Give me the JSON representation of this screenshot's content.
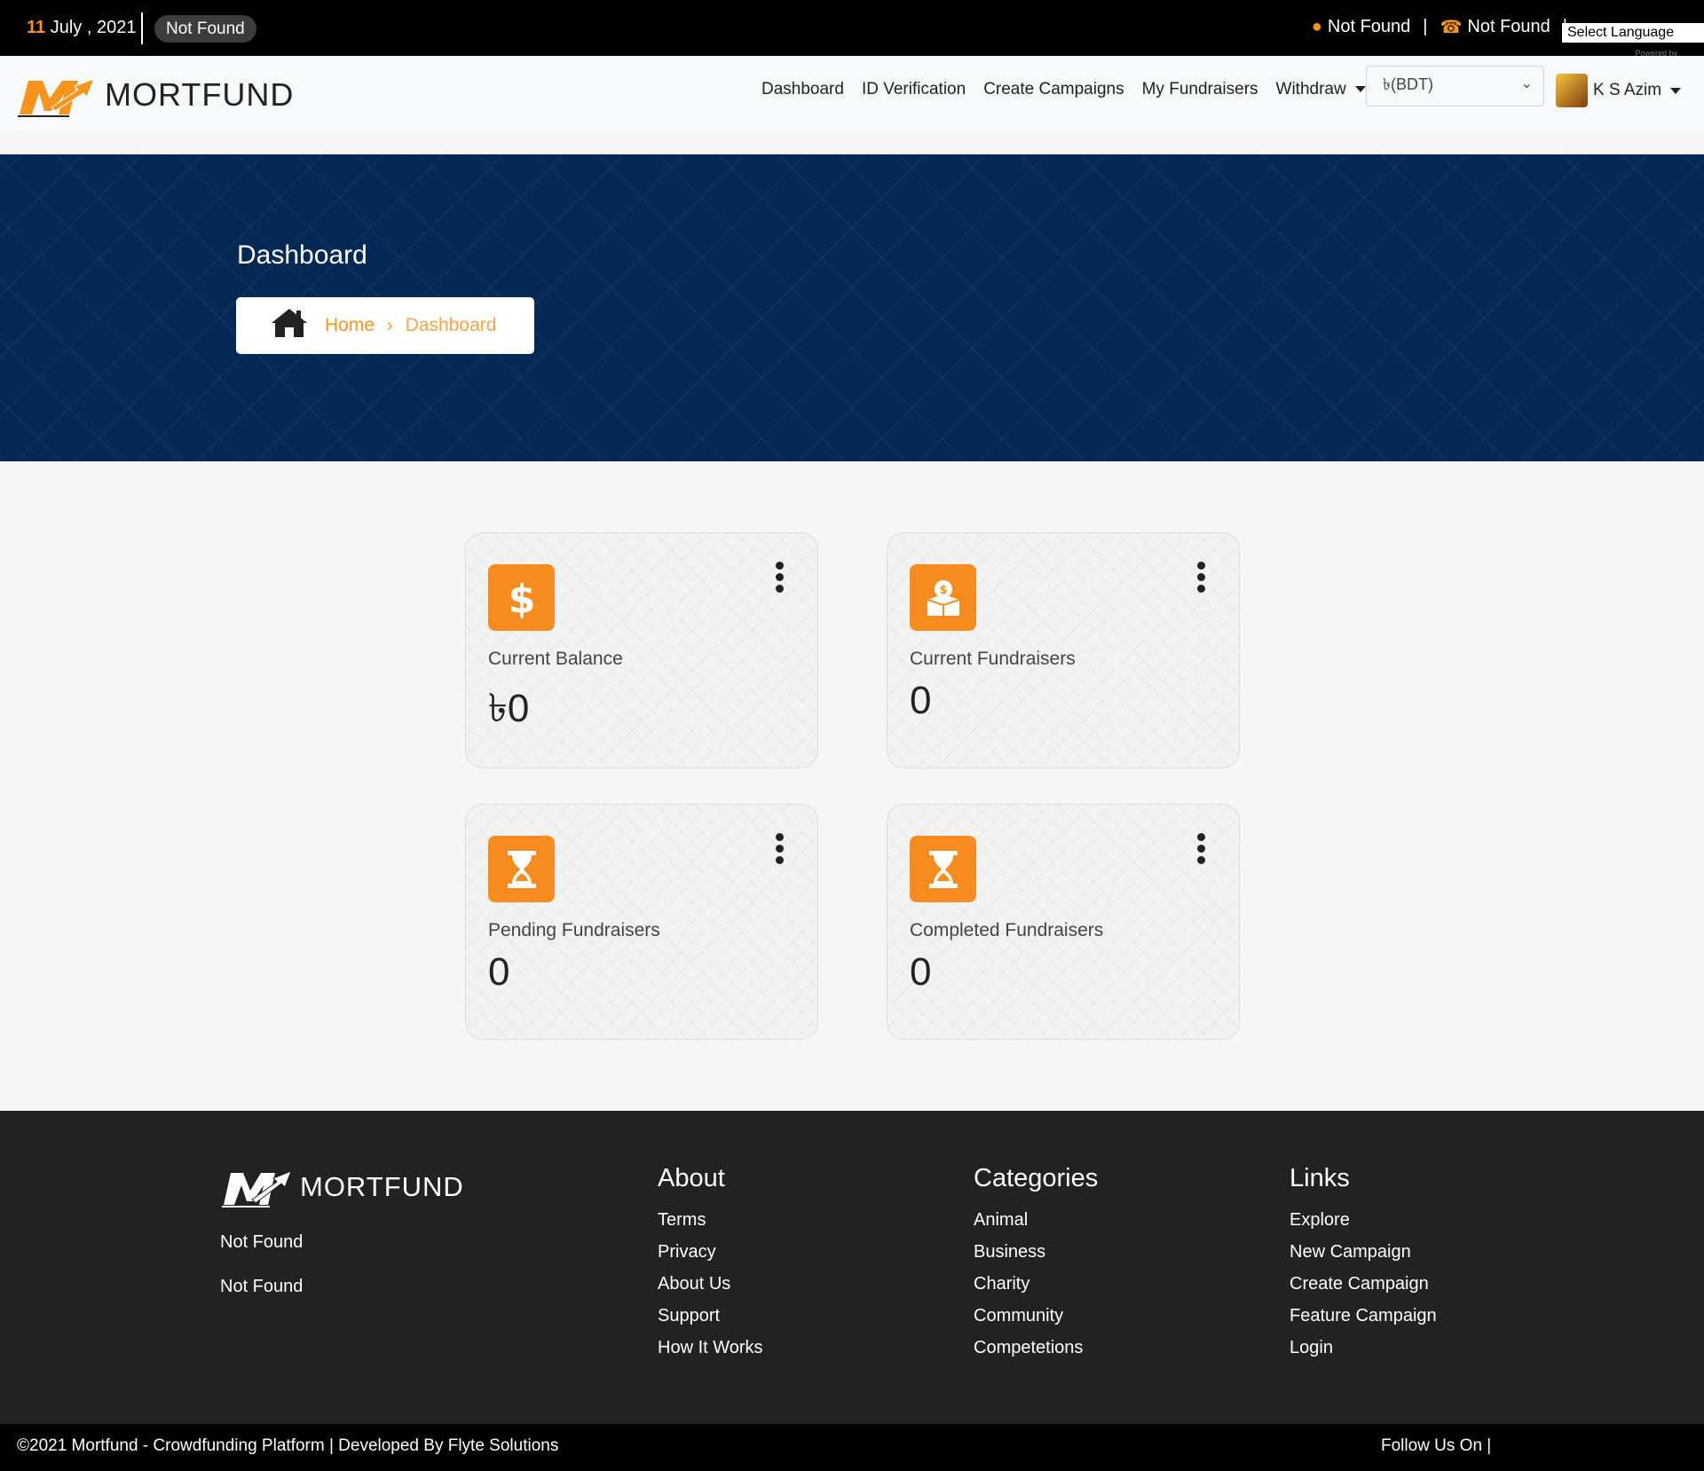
{
  "topbar": {
    "date_day": "11",
    "date_rest": " July , 2021",
    "status_pill": "Not Found",
    "address": "Not Found",
    "phone": "Not Found",
    "language_select": "Select Language",
    "powered_by": "Powered by"
  },
  "navbar": {
    "brand": "MORTFUND",
    "items": [
      "Dashboard",
      "ID Verification",
      "Create Campaigns",
      "My Fundraisers"
    ],
    "withdraw": "Withdraw",
    "currency": "৳(BDT)",
    "user_name": "K S Azim"
  },
  "hero": {
    "title": "Dashboard",
    "breadcrumb_home": "Home",
    "breadcrumb_current": "Dashboard"
  },
  "cards": [
    {
      "label": "Current Balance",
      "value": "৳0",
      "icon": "dollar-icon"
    },
    {
      "label": "Current Fundraisers",
      "value": "0",
      "icon": "donation-box-icon"
    },
    {
      "label": "Pending Fundraisers",
      "value": "0",
      "icon": "hourglass-icon"
    },
    {
      "label": "Completed Fundraisers",
      "value": "0",
      "icon": "hourglass-icon"
    }
  ],
  "footer": {
    "brand": "MORTFUND",
    "address": "Not Found",
    "phone": "Not Found",
    "about": {
      "title": "About",
      "links": [
        "Terms",
        "Privacy",
        "About Us",
        "Support",
        "How It Works"
      ]
    },
    "categories": {
      "title": "Categories",
      "links": [
        "Animal",
        "Business",
        "Charity",
        "Community",
        "Competetions"
      ]
    },
    "links": {
      "title": "Links",
      "links": [
        "Explore",
        "New Campaign",
        "Create Campaign",
        "Feature Campaign",
        "Login"
      ]
    },
    "copyright": "©2021 Mortfund - Crowdfunding Platform | Developed By Flyte Solutions",
    "follow": "Follow Us On |"
  },
  "colors": {
    "accent": "#f7941d",
    "hero_bg": "#052855",
    "footer_bg": "#222222",
    "topbar_bg": "#000000"
  }
}
